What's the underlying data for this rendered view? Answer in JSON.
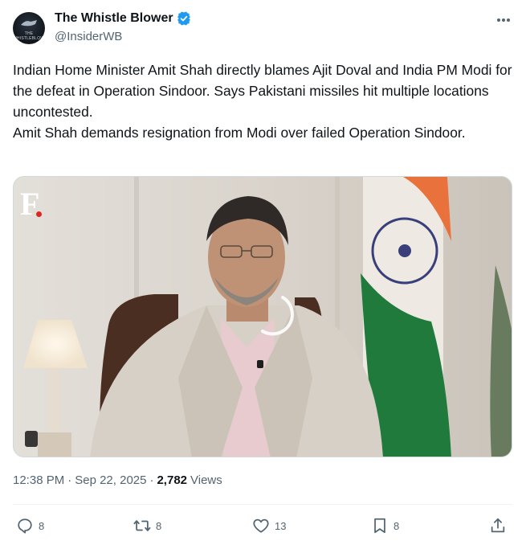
{
  "author": {
    "display_name": "The Whistle Blower",
    "handle": "@InsiderWB",
    "avatar_text": "THE WHISTLEBLOWER",
    "verified": true
  },
  "tweet": {
    "paragraph_1": "Indian Home Minister Amit Shah directly blames Ajit Doval and India PM Modi for the defeat in Operation Sindoor. Says Pakistani missiles hit multiple locations uncontested.",
    "paragraph_2": "Amit Shah demands resignation from Modi over failed Operation Sindoor."
  },
  "media": {
    "type": "video",
    "watermark": "F",
    "loading": true
  },
  "meta": {
    "time": "12:38 PM",
    "separator": "·",
    "date": "Sep 22, 2025",
    "views_count": "2,782",
    "views_label": "Views"
  },
  "actions": {
    "replies": "8",
    "reposts": "8",
    "likes": "13",
    "bookmarks": "8"
  },
  "colors": {
    "verified_blue": "#1d9bf0",
    "text_primary": "#0f1419",
    "text_secondary": "#536471"
  },
  "icons": [
    "verified-badge-icon",
    "more-options-icon",
    "reply-icon",
    "repost-icon",
    "like-icon",
    "bookmark-icon",
    "share-icon"
  ]
}
